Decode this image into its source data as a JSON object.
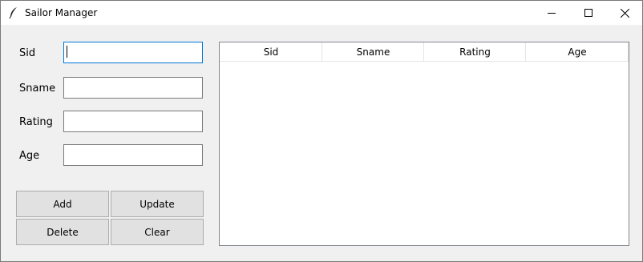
{
  "window": {
    "title": "Sailor Manager",
    "controls": {
      "minimize": "minimize",
      "maximize": "maximize",
      "close": "close"
    }
  },
  "form": {
    "fields": [
      {
        "label": "Sid",
        "value": ""
      },
      {
        "label": "Sname",
        "value": ""
      },
      {
        "label": "Rating",
        "value": ""
      },
      {
        "label": "Age",
        "value": ""
      }
    ]
  },
  "buttons": {
    "add": "Add",
    "update": "Update",
    "delete": "Delete",
    "clear": "Clear"
  },
  "table": {
    "columns": [
      "Sid",
      "Sname",
      "Rating",
      "Age"
    ],
    "rows": []
  },
  "icons": {
    "app": "feather-icon",
    "minimize": "minimize-icon",
    "maximize": "maximize-icon",
    "close": "close-icon"
  },
  "colors": {
    "focus_border": "#0078d7",
    "button_face": "#e1e1e1",
    "window_bg": "#f0f0f0"
  }
}
